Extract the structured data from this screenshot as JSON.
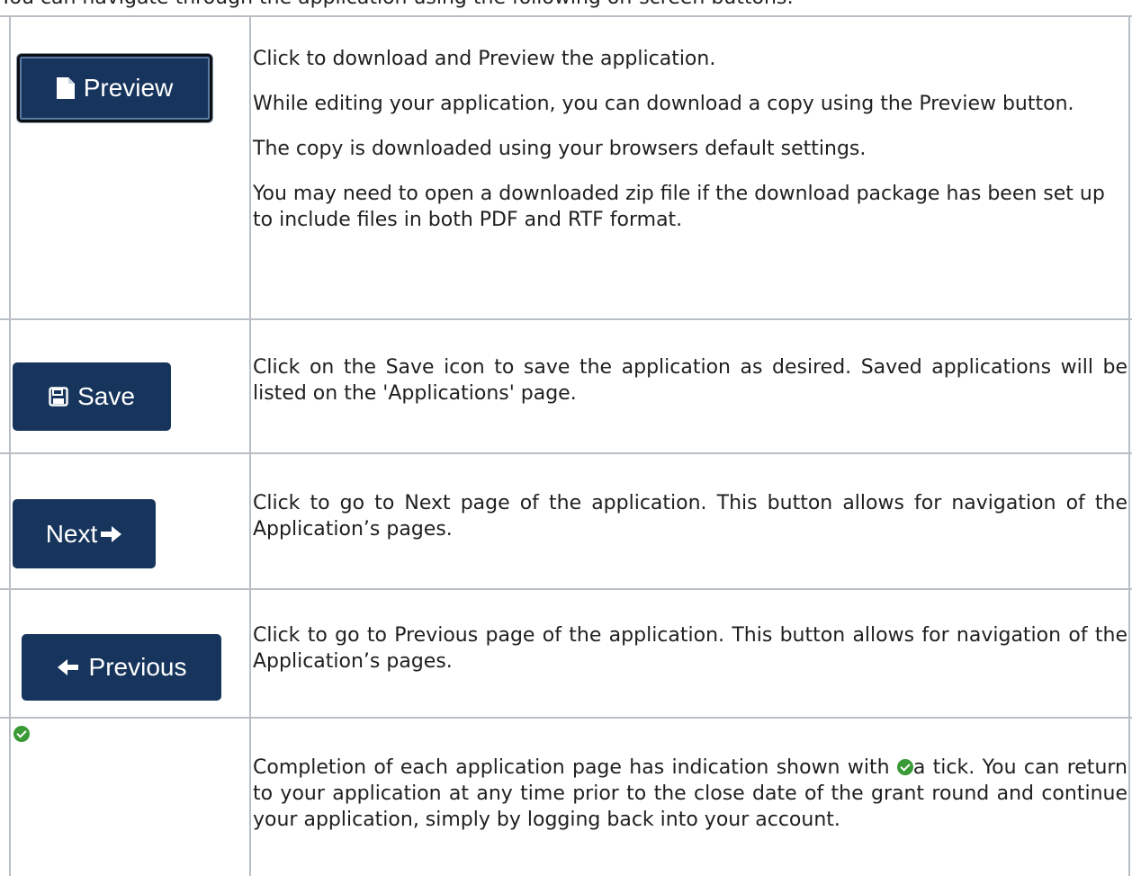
{
  "intro": "You can navigate through the application using the following on-screen buttons:",
  "colors": {
    "button_bg": "#17355c",
    "grid": "#b9bfc7",
    "tick_green": "#3a9a35"
  },
  "rows": [
    {
      "button": {
        "label": "Preview",
        "icon": "document-icon"
      },
      "paragraphs": [
        "Click to download and Preview the application.",
        "While editing your application, you can download a copy using the Preview button.",
        "The copy is downloaded using your browsers default settings.",
        "You may need to open a downloaded zip file if the download package has been set up to include files in both PDF and RTF format."
      ]
    },
    {
      "button": {
        "label": "Save",
        "icon": "floppy-disk-icon"
      },
      "paragraphs": [
        "Click on the Save icon to save the application as desired. Saved applications will be listed on the 'Applications' page."
      ]
    },
    {
      "button": {
        "label": "Next",
        "icon": "arrow-right-icon"
      },
      "paragraphs": [
        "Click to go to Next page of the application. This button allows for navigation of the Application’s pages."
      ]
    },
    {
      "button": {
        "label": "Previous",
        "icon": "arrow-left-icon"
      },
      "paragraphs": [
        "Click to go to Previous page of the application. This button allows for navigation of the Application’s pages."
      ]
    },
    {
      "button": {
        "label": "",
        "icon": "green-tick-icon"
      },
      "paragraphs": [
        "Completion of each application page has indication shown with ",
        "a tick.  You can return to your application at any time prior to the close date of the grant round and continue your application, simply by logging back into your account."
      ]
    }
  ]
}
